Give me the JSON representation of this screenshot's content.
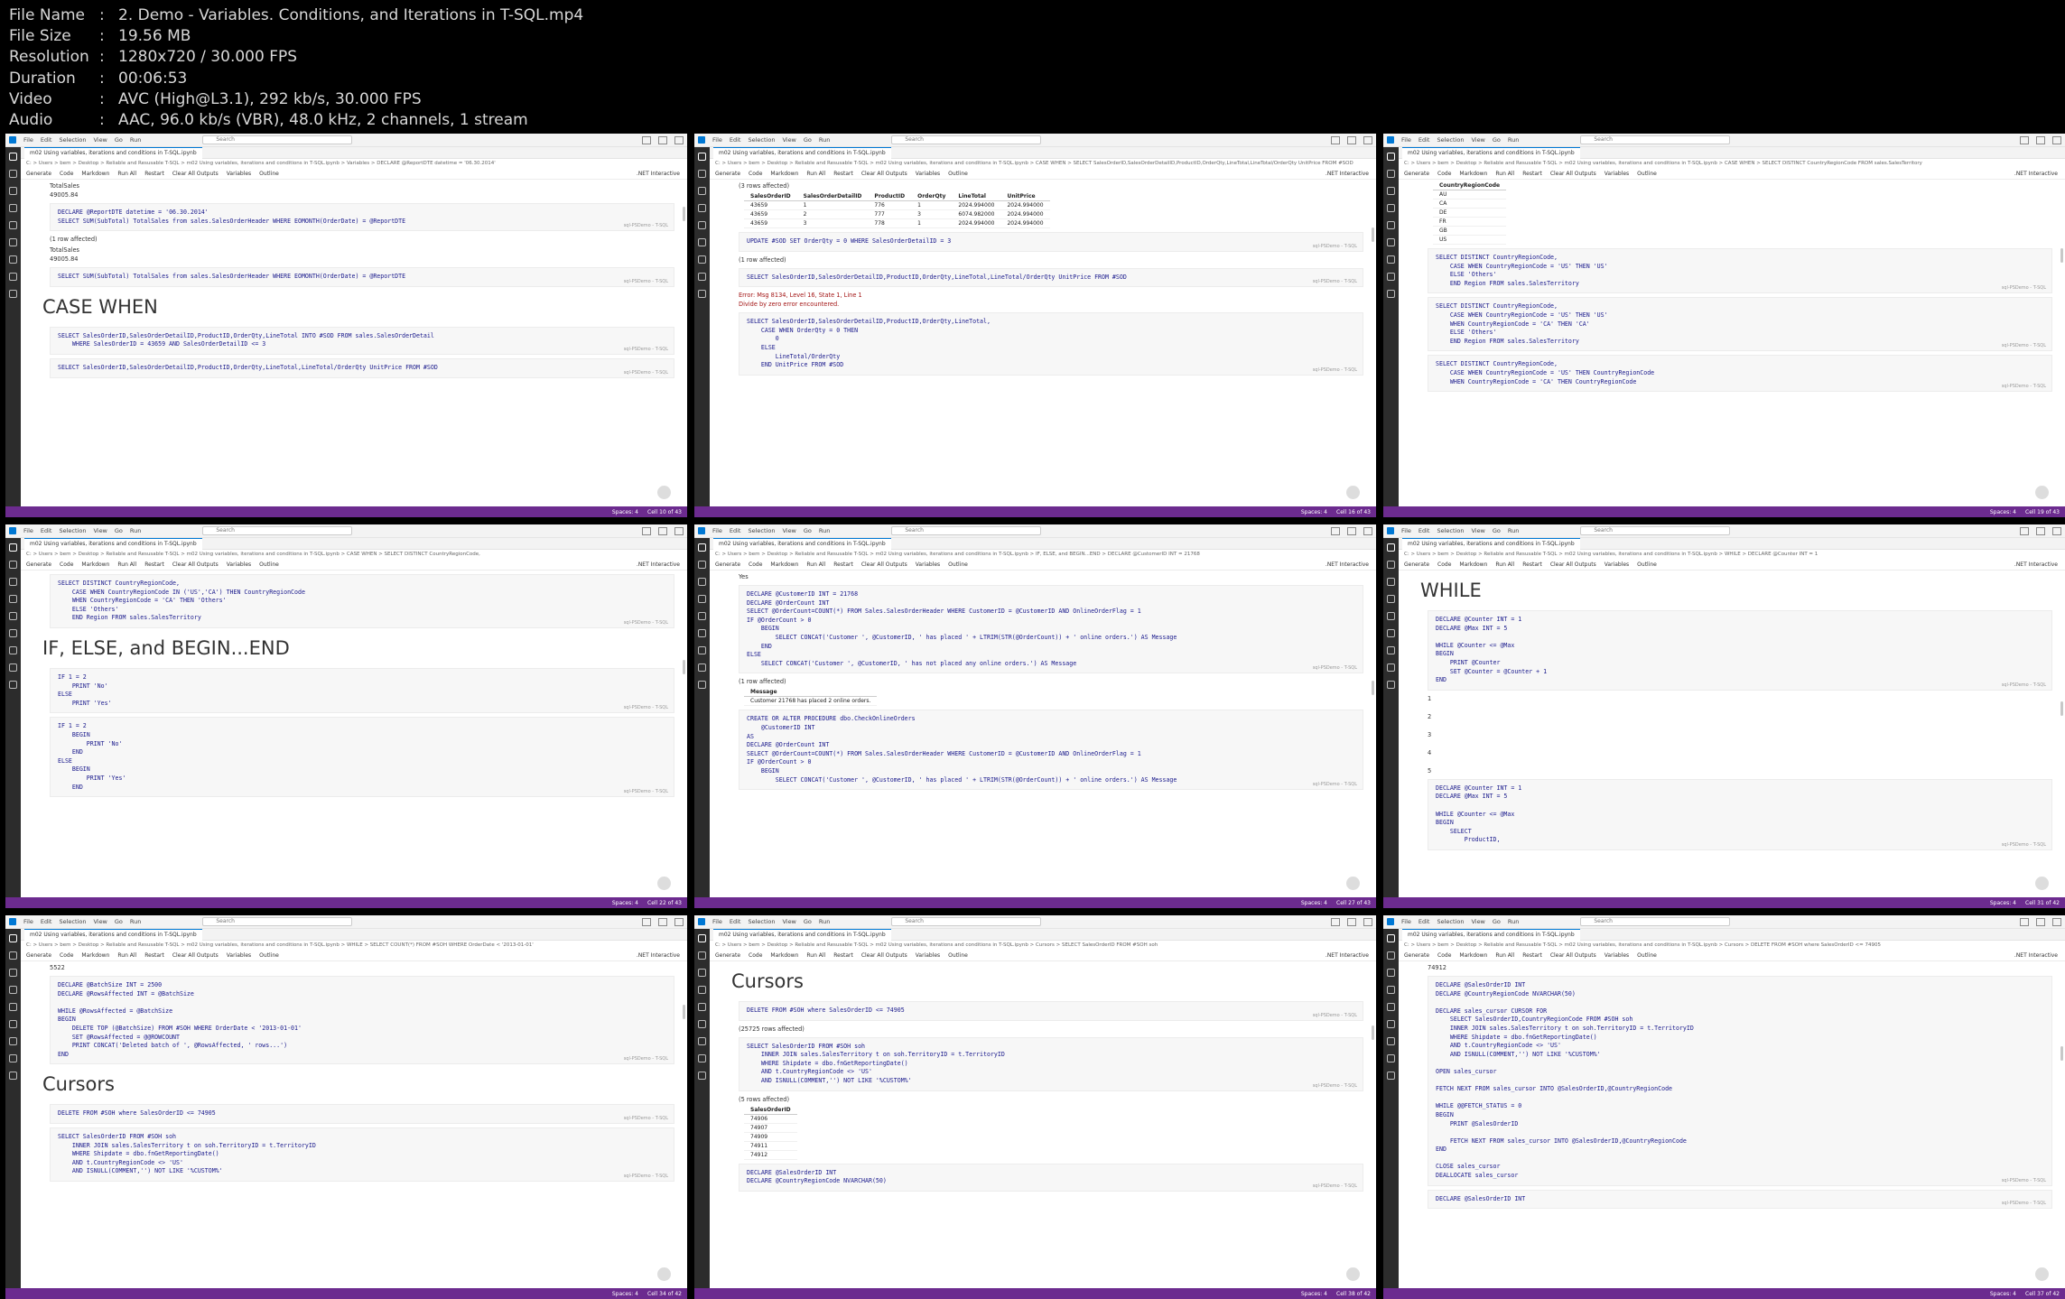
{
  "file_info": [
    {
      "key": "File Name",
      "value": "2. Demo - Variables. Conditions, and Iterations in T-SQL.mp4"
    },
    {
      "key": "File Size",
      "value": "19.56 MB"
    },
    {
      "key": "Resolution",
      "value": "1280x720 / 30.000 FPS"
    },
    {
      "key": "Duration",
      "value": "00:06:53"
    },
    {
      "key": "Video",
      "value": "AVC (High@L3.1), 292 kb/s, 30.000 FPS"
    },
    {
      "key": "Audio",
      "value": "AAC, 96.0 kb/s (VBR), 48.0 kHz, 2 channels, 1 stream"
    }
  ],
  "colors": {
    "statusbar": "#6c2b8f",
    "activitybar": "#2c2c2c",
    "code": "#1a1a8c",
    "error": "#a31515"
  },
  "common": {
    "menu": [
      "File",
      "Edit",
      "Selection",
      "View",
      "Go",
      "Run"
    ],
    "search": "Search",
    "tab": "m02 Using variables, iterations and conditions in T-SQL.ipynb",
    "toolbar": [
      "Generate",
      "Code",
      "Markdown",
      "Run All",
      "Restart",
      "Clear All Outputs",
      "Variables",
      "Outline"
    ],
    "kernel": ".NET Interactive",
    "lang": "sql-PSDemo - T-SQL",
    "spaces": "Spaces: 4"
  },
  "thumbs": [
    {
      "breadcrumb": "C: > Users > bem > Desktop > Reliable and Resusable T-SQL > m02 Using variables, iterations and conditions in T-SQL.ipynb > Variables > DECLARE @ReportDTE datetime = '06.30.2014'",
      "cell_status": "Cell 10 of 43",
      "blocks": [
        {
          "t": "out",
          "text": "TotalSales\n49005.84"
        },
        {
          "t": "code",
          "text": "DECLARE @ReportDTE datetime = '06.30.2014'\nSELECT SUM(SubTotal) TotalSales from sales.SalesOrderHeader WHERE EOMONTH(OrderDate) = @ReportDTE"
        },
        {
          "t": "out",
          "text": "(1 row affected)"
        },
        {
          "t": "out",
          "text": "TotalSales\n49005.84"
        },
        {
          "t": "code",
          "text": "SELECT SUM(SubTotal) TotalSales from sales.SalesOrderHeader WHERE EOMONTH(OrderDate) = @ReportDTE"
        },
        {
          "t": "heading",
          "text": "CASE WHEN"
        },
        {
          "t": "code",
          "text": "SELECT SalesOrderID,SalesOrderDetailID,ProductID,OrderQty,LineTotal INTO #SOD FROM sales.SalesOrderDetail\n    WHERE SalesOrderID = 43659 AND SalesOrderDetailID <= 3"
        },
        {
          "t": "code",
          "text": "SELECT SalesOrderID,SalesOrderDetailID,ProductID,OrderQty,LineTotal,LineTotal/OrderQty UnitPrice FROM #SOD"
        }
      ]
    },
    {
      "breadcrumb": "C: > Users > bem > Desktop > Reliable and Resusable T-SQL > m02 Using variables, iterations and conditions in T-SQL.ipynb > CASE WHEN > SELECT SalesOrderID,SalesOrderDetailID,ProductID,OrderQty,LineTotal,LineTotal/OrderQty UnitPrice FROM #SOD",
      "cell_status": "Cell 16 of 43",
      "blocks": [
        {
          "t": "out",
          "text": "(3 rows affected)"
        },
        {
          "t": "table",
          "headers": [
            "SalesOrderID",
            "SalesOrderDetailID",
            "ProductID",
            "OrderQty",
            "LineTotal",
            "UnitPrice"
          ],
          "rows": [
            [
              "43659",
              "1",
              "776",
              "1",
              "2024.994000",
              "2024.994000"
            ],
            [
              "43659",
              "2",
              "777",
              "3",
              "6074.982000",
              "2024.994000"
            ],
            [
              "43659",
              "3",
              "778",
              "1",
              "2024.994000",
              "2024.994000"
            ]
          ]
        },
        {
          "t": "code",
          "text": "UPDATE #SOD SET OrderQty = 0 WHERE SalesOrderDetailID = 3"
        },
        {
          "t": "out",
          "text": "(1 row affected)"
        },
        {
          "t": "code",
          "text": "SELECT SalesOrderID,SalesOrderDetailID,ProductID,OrderQty,LineTotal,LineTotal/OrderQty UnitPrice FROM #SOD"
        },
        {
          "t": "err",
          "text": "Error: Msg 8134, Level 16, State 1, Line 1\nDivide by zero error encountered."
        },
        {
          "t": "code",
          "text": "SELECT SalesOrderID,SalesOrderDetailID,ProductID,OrderQty,LineTotal,\n    CASE WHEN OrderQty = 0 THEN\n        0\n    ELSE\n        LineTotal/OrderQty\n    END UnitPrice FROM #SOD"
        }
      ]
    },
    {
      "breadcrumb": "C: > Users > bem > Desktop > Reliable and Resusable T-SQL > m02 Using variables, iterations and conditions in T-SQL.ipynb > CASE WHEN > SELECT DISTINCT CountryRegionCode FROM sales.SalesTerritory",
      "cell_status": "Cell 19 of 43",
      "blocks": [
        {
          "t": "table",
          "headers": [
            "CountryRegionCode"
          ],
          "rows": [
            [
              "AU"
            ],
            [
              "CA"
            ],
            [
              "DE"
            ],
            [
              "FR"
            ],
            [
              "GB"
            ],
            [
              "US"
            ]
          ]
        },
        {
          "t": "code",
          "text": "SELECT DISTINCT CountryRegionCode,\n    CASE WHEN CountryRegionCode = 'US' THEN 'US'\n    ELSE 'Others'\n    END Region FROM sales.SalesTerritory"
        },
        {
          "t": "code",
          "text": "SELECT DISTINCT CountryRegionCode,\n    CASE WHEN CountryRegionCode = 'US' THEN 'US'\n    WHEN CountryRegionCode = 'CA' THEN 'CA'\n    ELSE 'Others'\n    END Region FROM sales.SalesTerritory"
        },
        {
          "t": "code",
          "text": "SELECT DISTINCT CountryRegionCode,\n    CASE WHEN CountryRegionCode = 'US' THEN CountryRegionCode\n    WHEN CountryRegionCode = 'CA' THEN CountryRegionCode"
        }
      ]
    },
    {
      "breadcrumb": "C: > Users > bem > Desktop > Reliable and Resusable T-SQL > m02 Using variables, iterations and conditions in T-SQL.ipynb > CASE WHEN > SELECT DISTINCT CountryRegionCode,",
      "cell_status": "Cell 22 of 43",
      "blocks": [
        {
          "t": "code",
          "text": "SELECT DISTINCT CountryRegionCode,\n    CASE WHEN CountryRegionCode IN ('US','CA') THEN CountryRegionCode\n    WHEN CountryRegionCode = 'CA' THEN 'Others'\n    ELSE 'Others'\n    END Region FROM sales.SalesTerritory"
        },
        {
          "t": "heading",
          "text": "IF, ELSE, and BEGIN...END"
        },
        {
          "t": "code",
          "text": "IF 1 = 2\n    PRINT 'No'\nELSE\n    PRINT 'Yes'"
        },
        {
          "t": "code",
          "text": "IF 1 = 2\n    BEGIN\n        PRINT 'No'\n    END\nELSE\n    BEGIN\n        PRINT 'Yes'\n    END"
        }
      ]
    },
    {
      "breadcrumb": "C: > Users > bem > Desktop > Reliable and Resusable T-SQL > m02 Using variables, iterations and conditions in T-SQL.ipynb > IF, ELSE, and BEGIN...END > DECLARE @CustomerID INT = 21768",
      "cell_status": "Cell 27 of 43",
      "blocks": [
        {
          "t": "out",
          "text": "Yes"
        },
        {
          "t": "code",
          "text": "DECLARE @CustomerID INT = 21768\nDECLARE @OrderCount INT\nSELECT @OrderCount=COUNT(*) FROM Sales.SalesOrderHeader WHERE CustomerID = @CustomerID AND OnlineOrderFlag = 1\nIF @OrderCount > 0\n    BEGIN\n        SELECT CONCAT('Customer ', @CustomerID, ' has placed ' + LTRIM(STR(@OrderCount)) + ' online orders.') AS Message\n    END\nELSE\n    SELECT CONCAT('Customer ', @CustomerID, ' has not placed any online orders.') AS Message"
        },
        {
          "t": "out",
          "text": "(1 row affected)"
        },
        {
          "t": "table",
          "headers": [
            "Message"
          ],
          "rows": [
            [
              "Customer 21768 has placed 2 online orders."
            ]
          ]
        },
        {
          "t": "code",
          "text": "CREATE OR ALTER PROCEDURE dbo.CheckOnlineOrders\n    @CustomerID INT\nAS\nDECLARE @OrderCount INT\nSELECT @OrderCount=COUNT(*) FROM Sales.SalesOrderHeader WHERE CustomerID = @CustomerID AND OnlineOrderFlag = 1\nIF @OrderCount > 0\n    BEGIN\n        SELECT CONCAT('Customer ', @CustomerID, ' has placed ' + LTRIM(STR(@OrderCount)) + ' online orders.') AS Message"
        }
      ]
    },
    {
      "breadcrumb": "C: > Users > bem > Desktop > Reliable and Resusable T-SQL > m02 Using variables, iterations and conditions in T-SQL.ipynb > WHILE > DECLARE @Counter INT = 1",
      "cell_status": "Cell 31 of 42",
      "blocks": [
        {
          "t": "heading",
          "text": "WHILE"
        },
        {
          "t": "code",
          "text": "DECLARE @Counter INT = 1\nDECLARE @Max INT = 5\n\nWHILE @Counter <= @Max\nBEGIN\n    PRINT @Counter\n    SET @Counter = @Counter + 1\nEND"
        },
        {
          "t": "out",
          "text": "1\n\n2\n\n3\n\n4\n\n5"
        },
        {
          "t": "code",
          "text": "DECLARE @Counter INT = 1\nDECLARE @Max INT = 5\n\nWHILE @Counter <= @Max\nBEGIN\n    SELECT\n        ProductID,"
        }
      ]
    },
    {
      "breadcrumb": "C: > Users > bem > Desktop > Reliable and Resusable T-SQL > m02 Using variables, iterations and conditions in T-SQL.ipynb > WHILE > SELECT COUNT(*) FROM #SOH WHERE OrderDate < '2013-01-01'",
      "cell_status": "Cell 34 of 42",
      "blocks": [
        {
          "t": "out",
          "text": "5522"
        },
        {
          "t": "code",
          "text": "DECLARE @BatchSize INT = 2500\nDECLARE @RowsAffected INT = @BatchSize\n\nWHILE @RowsAffected = @BatchSize\nBEGIN\n    DELETE TOP (@BatchSize) FROM #SOH WHERE OrderDate < '2013-01-01'\n    SET @RowsAffected = @@ROWCOUNT\n    PRINT CONCAT('Deleted batch of ', @RowsAffected, ' rows...')\nEND"
        },
        {
          "t": "heading",
          "text": "Cursors"
        },
        {
          "t": "code",
          "text": "DELETE FROM #SOH where SalesOrderID <= 74905"
        },
        {
          "t": "code",
          "text": "SELECT SalesOrderID FROM #SOH soh\n    INNER JOIN sales.SalesTerritory t on soh.TerritoryID = t.TerritoryID\n    WHERE Shipdate = dbo.fnGetReportingDate()\n    AND t.CountryRegionCode <> 'US'\n    AND ISNULL(COMMENT,'') NOT LIKE '%CUSTOM%'"
        }
      ]
    },
    {
      "breadcrumb": "C: > Users > bem > Desktop > Reliable and Resusable T-SQL > m02 Using variables, iterations and conditions in T-SQL.ipynb > Cursors > SELECT SalesOrderID FROM #SOH soh",
      "cell_status": "Cell 38 of 42",
      "blocks": [
        {
          "t": "heading",
          "text": "Cursors"
        },
        {
          "t": "code",
          "text": "DELETE FROM #SOH where SalesOrderID <= 74905"
        },
        {
          "t": "out",
          "text": "(25725 rows affected)"
        },
        {
          "t": "code",
          "text": "SELECT SalesOrderID FROM #SOH soh\n    INNER JOIN sales.SalesTerritory t on soh.TerritoryID = t.TerritoryID\n    WHERE Shipdate = dbo.fnGetReportingDate()\n    AND t.CountryRegionCode <> 'US'\n    AND ISNULL(COMMENT,'') NOT LIKE '%CUSTOM%'"
        },
        {
          "t": "out",
          "text": "(5 rows affected)"
        },
        {
          "t": "table",
          "headers": [
            "SalesOrderID"
          ],
          "rows": [
            [
              "74906"
            ],
            [
              "74907"
            ],
            [
              "74909"
            ],
            [
              "74911"
            ],
            [
              "74912"
            ]
          ]
        },
        {
          "t": "code",
          "text": "DECLARE @SalesOrderID INT\nDECLARE @CountryRegionCode NVARCHAR(50)"
        }
      ]
    },
    {
      "breadcrumb": "C: > Users > bem > Desktop > Reliable and Resusable T-SQL > m02 Using variables, iterations and conditions in T-SQL.ipynb > Cursors > DELETE FROM #SOH where SalesOrderID <= 74905",
      "cell_status": "Cell 37 of 42",
      "blocks": [
        {
          "t": "out",
          "text": "74912"
        },
        {
          "t": "code",
          "text": "DECLARE @SalesOrderID INT\nDECLARE @CountryRegionCode NVARCHAR(50)\n\nDECLARE sales_cursor CURSOR FOR\n    SELECT SalesOrderID,CountryRegionCode FROM #SOH soh\n    INNER JOIN sales.SalesTerritory t on soh.TerritoryID = t.TerritoryID\n    WHERE Shipdate = dbo.fnGetReportingDate()\n    AND t.CountryRegionCode <> 'US'\n    AND ISNULL(COMMENT,'') NOT LIKE '%CUSTOM%'\n\nOPEN sales_cursor\n\nFETCH NEXT FROM sales_cursor INTO @SalesOrderID,@CountryRegionCode\n\nWHILE @@FETCH_STATUS = 0\nBEGIN\n    PRINT @SalesOrderID\n\n    FETCH NEXT FROM sales_cursor INTO @SalesOrderID,@CountryRegionCode\nEND\n\nCLOSE sales_cursor\nDEALLOCATE sales_cursor"
        },
        {
          "t": "code",
          "text": "DECLARE @SalesOrderID INT"
        }
      ]
    }
  ]
}
